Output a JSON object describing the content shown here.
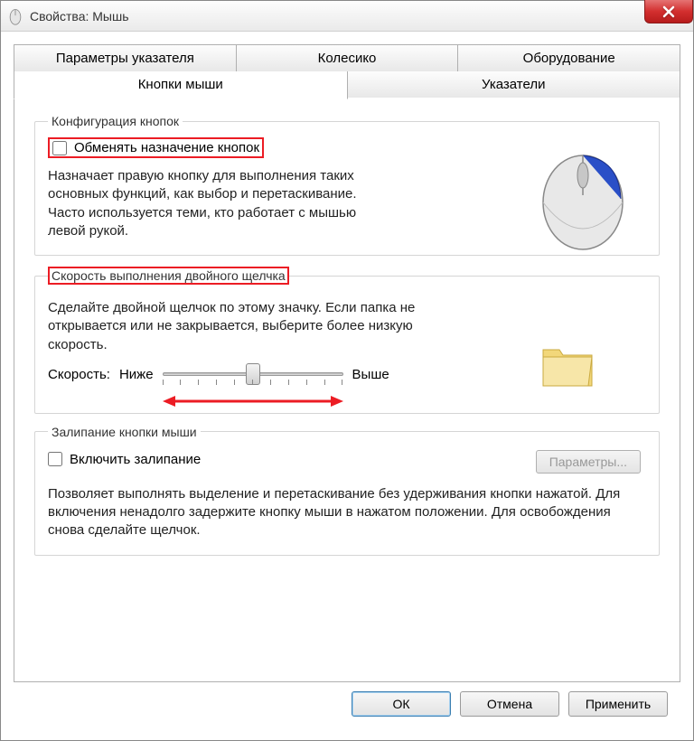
{
  "window": {
    "title": "Свойства: Мышь"
  },
  "tabs": {
    "row1": [
      "Параметры указателя",
      "Колесико",
      "Оборудование"
    ],
    "row2": [
      "Кнопки мыши",
      "Указатели"
    ],
    "active": "Кнопки мыши"
  },
  "group_buttons": {
    "legend": "Конфигурация кнопок",
    "swap_label": "Обменять назначение кнопок",
    "swap_checked": false,
    "description": "Назначает правую кнопку для выполнения таких основных функций, как выбор и перетаскивание. Часто используется теми, кто работает с мышью левой рукой."
  },
  "group_doubleclick": {
    "legend": "Скорость выполнения двойного щелчка",
    "description": "Сделайте двойной щелчок по этому значку. Если папка не открывается или не закрывается, выберите более низкую скорость.",
    "speed_label": "Скорость:",
    "slower_label": "Ниже",
    "faster_label": "Выше"
  },
  "group_clicklock": {
    "legend": "Залипание кнопки мыши",
    "enable_label": "Включить залипание",
    "enable_checked": false,
    "params_button": "Параметры...",
    "description": "Позволяет выполнять выделение и перетаскивание без удерживания кнопки нажатой. Для включения ненадолго задержите кнопку мыши в нажатом положении. Для освобождения снова сделайте щелчок."
  },
  "buttons": {
    "ok": "ОК",
    "cancel": "Отмена",
    "apply": "Применить"
  }
}
